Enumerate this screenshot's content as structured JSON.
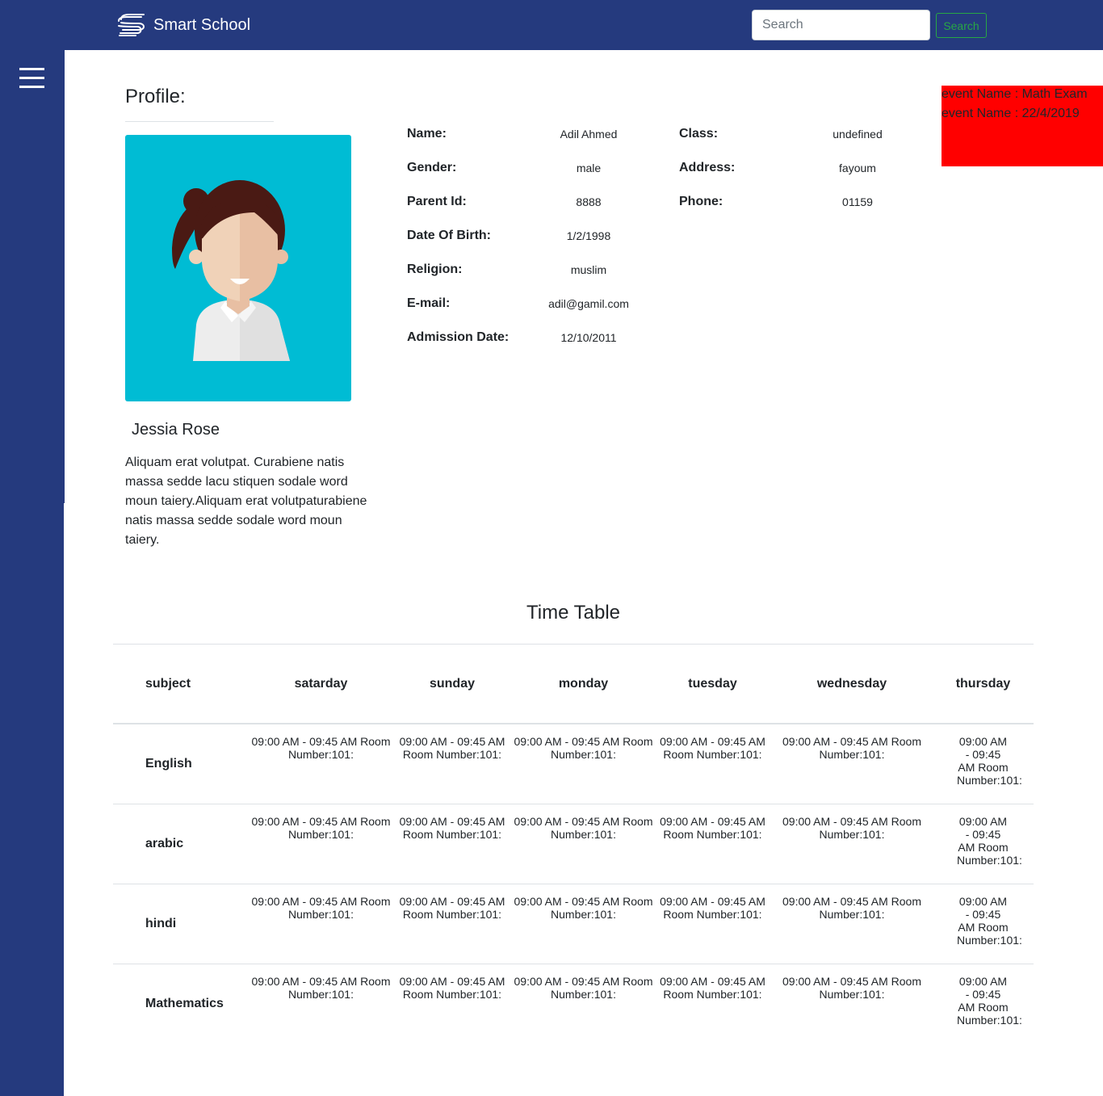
{
  "header": {
    "brand": "Smart School",
    "search_placeholder": "Search",
    "search_button": "Search"
  },
  "profile": {
    "title": "Profile:",
    "student_name": "Jessia Rose",
    "bio": "Aliquam erat volutpat. Curabiene natis massa sedde lacu stiquen sodale word moun taiery.Aliquam erat volutpaturabiene natis massa sedde sodale word moun taiery."
  },
  "details": {
    "left": [
      {
        "label": "Name:",
        "value": "Adil Ahmed"
      },
      {
        "label": "Gender:",
        "value": "male"
      },
      {
        "label": "Parent Id:",
        "value": "8888"
      },
      {
        "label": "Date Of Birth:",
        "value": "1/2/1998"
      },
      {
        "label": "Religion:",
        "value": "muslim"
      },
      {
        "label": "E-mail:",
        "value": "adil@gamil.com"
      },
      {
        "label": "Admission Date:",
        "value": "12/10/2011"
      }
    ],
    "right": [
      {
        "label": "Class:",
        "value": "undefined"
      },
      {
        "label": "Address:",
        "value": "fayoum"
      },
      {
        "label": "Phone:",
        "value": "01159"
      }
    ]
  },
  "event": {
    "line1": "event Name : Math Exam",
    "line2": "event Name : 22/4/2019",
    "color": "#ff0000"
  },
  "timetable": {
    "title": "Time Table",
    "headers": [
      "subject",
      "satarday",
      "sunday",
      "monday",
      "tuesday",
      "wednesday",
      "thursday"
    ],
    "cell_text": "09:00 AM - 09:45 AM Room Number:101:",
    "rows": [
      "English",
      "arabic",
      "hindi",
      "Mathematics"
    ]
  },
  "colors": {
    "primary": "#253a7e",
    "avatar_bg": "#00bcd4",
    "search_button": "#28a745"
  },
  "icons": {
    "menu": "hamburger-icon",
    "logo": "smart-school-logo"
  }
}
